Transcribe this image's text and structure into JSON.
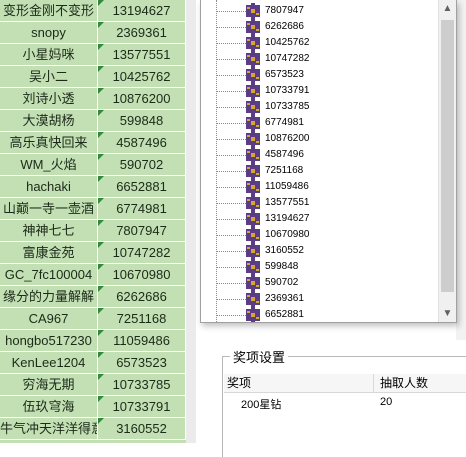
{
  "sheet": {
    "rows": [
      {
        "name": "变形金刚不变形",
        "value": "13194627"
      },
      {
        "name": "snopy",
        "value": "2369361"
      },
      {
        "name": "小星妈咪",
        "value": "13577551"
      },
      {
        "name": "吴小二",
        "value": "10425762"
      },
      {
        "name": "刘诗小透",
        "value": "10876200"
      },
      {
        "name": "大漠胡杨",
        "value": "599848"
      },
      {
        "name": "高乐真快回来",
        "value": "4587496"
      },
      {
        "name": "WM_火焰",
        "value": "590702"
      },
      {
        "name": "hachaki",
        "value": "6652881"
      },
      {
        "name": "山巅一寺一壶酒",
        "value": "6774981"
      },
      {
        "name": "神神七七",
        "value": "7807947"
      },
      {
        "name": "富康金苑",
        "value": "10747282"
      },
      {
        "name": "GC_7fc100004",
        "value": "10670980"
      },
      {
        "name": "缘分的力量解解",
        "value": "6262686"
      },
      {
        "name": "CA967",
        "value": "7251168"
      },
      {
        "name": "hongbo517230",
        "value": "11059486"
      },
      {
        "name": "KenLee1204",
        "value": "6573523"
      },
      {
        "name": "穷海无期",
        "value": "10733785"
      },
      {
        "name": "伍玖穹海",
        "value": "10733791"
      },
      {
        "name": "牛气冲天洋洋得意",
        "value": "3160552"
      }
    ]
  },
  "dropdown": {
    "items": [
      "7807947",
      "6262686",
      "10425762",
      "10747282",
      "6573523",
      "10733791",
      "10733785",
      "6774981",
      "10876200",
      "4587496",
      "7251168",
      "11059486",
      "13577551",
      "13194627",
      "10670980",
      "3160552",
      "599848",
      "590702",
      "2369361",
      "6652881"
    ],
    "scroll_up": "▲",
    "scroll_down": "▼"
  },
  "prize_group": {
    "title": "奖项设置",
    "columns": [
      "奖项",
      "抽取人数"
    ],
    "rows": [
      {
        "prize": "200星钻",
        "count": "20"
      }
    ]
  },
  "colors": {
    "sheet_bg": "#c3e0b5",
    "icon_purple": "#5a3d86",
    "icon_gold": "#d9a72a"
  }
}
